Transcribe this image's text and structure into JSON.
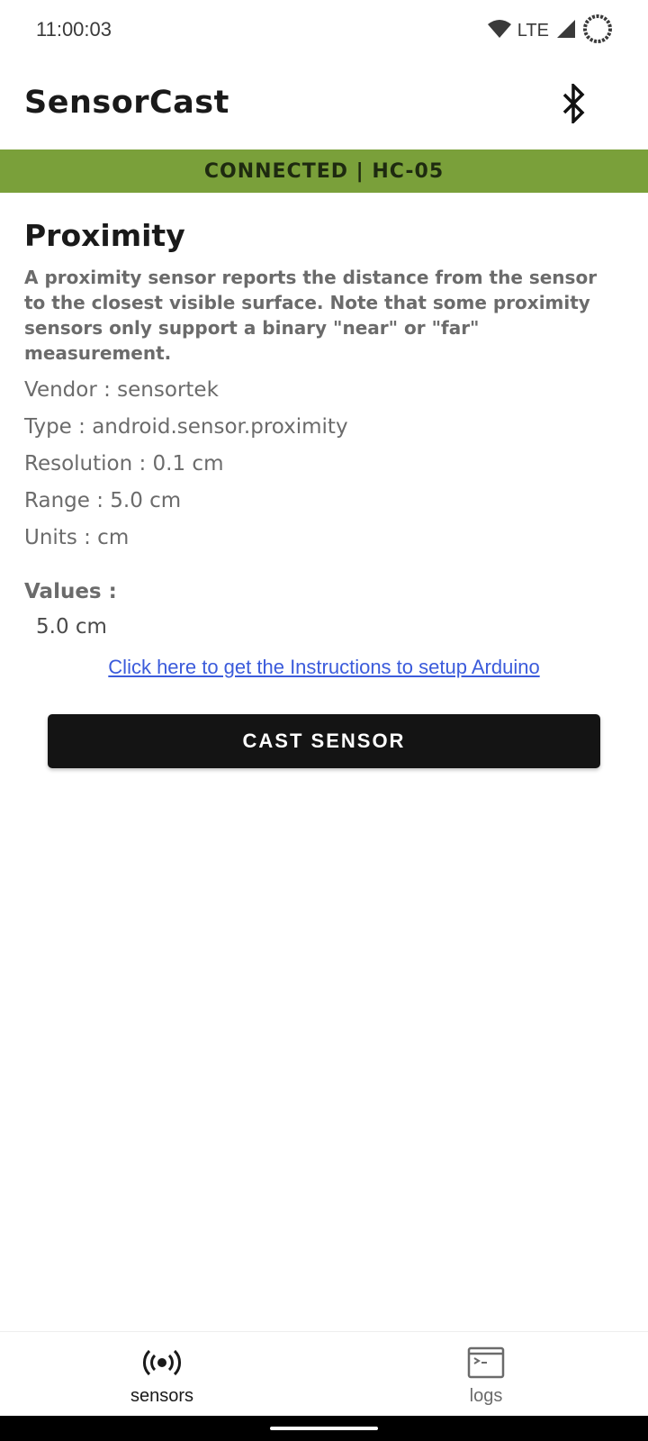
{
  "status_bar": {
    "time": "11:00:03",
    "network": "LTE",
    "icons": [
      "wifi-icon",
      "cell-signal-icon",
      "battery-ring-icon"
    ]
  },
  "app_bar": {
    "title": "SensorCast",
    "action_icon": "bluetooth-icon"
  },
  "connection": {
    "text": "CONNECTED | HC-05",
    "color": "#7aa03a"
  },
  "sensor": {
    "name": "Proximity",
    "description": "A proximity sensor reports the distance from the sensor to the closest visible surface. Note that some proximity sensors only support a binary \"near\" or \"far\" measurement.",
    "vendor": "Vendor : sensortek",
    "type": "Type : android.sensor.proximity",
    "resolution": "Resolution : 0.1 cm",
    "range": "Range : 5.0 cm",
    "units": "Units : cm",
    "values_label": "Values :",
    "value": "5.0 cm"
  },
  "instructions_link": "Click here to get the Instructions to setup Arduino",
  "cast_button": "CAST SENSOR",
  "bottom_nav": {
    "items": [
      {
        "label": "sensors",
        "icon": "broadcast-icon",
        "active": true
      },
      {
        "label": "logs",
        "icon": "terminal-icon",
        "active": false
      }
    ]
  }
}
